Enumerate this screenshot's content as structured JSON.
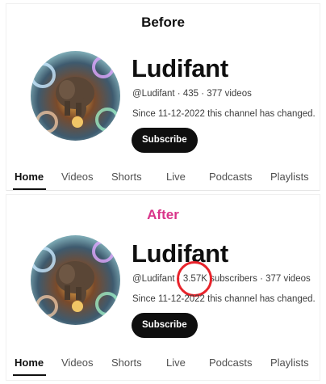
{
  "before": {
    "label": "Before",
    "channel_name": "Ludifant",
    "meta": "@Ludifant · 435 · 377 videos",
    "description": "Since 11-12-2022 this channel has changed.",
    "subscribe_label": "Subscribe",
    "tabs": [
      "Home",
      "Videos",
      "Shorts",
      "Live",
      "Podcasts",
      "Playlists"
    ],
    "active_tab": "Home"
  },
  "after": {
    "label": "After",
    "label_color": "#d9348a",
    "channel_name": "Ludifant",
    "meta_handle": "@Ludifant ·",
    "meta_subs": "3.57K",
    "meta_rest": "subscribers · 377 videos",
    "description": "Since 11-12-2022 this channel has changed.",
    "subscribe_label": "Subscribe",
    "tabs": [
      "Home",
      "Videos",
      "Shorts",
      "Live",
      "Podcasts",
      "Playlists"
    ],
    "active_tab": "Home"
  },
  "colors": {
    "highlight": "#e8232b",
    "subscribe_bg": "#0f0f0f"
  }
}
